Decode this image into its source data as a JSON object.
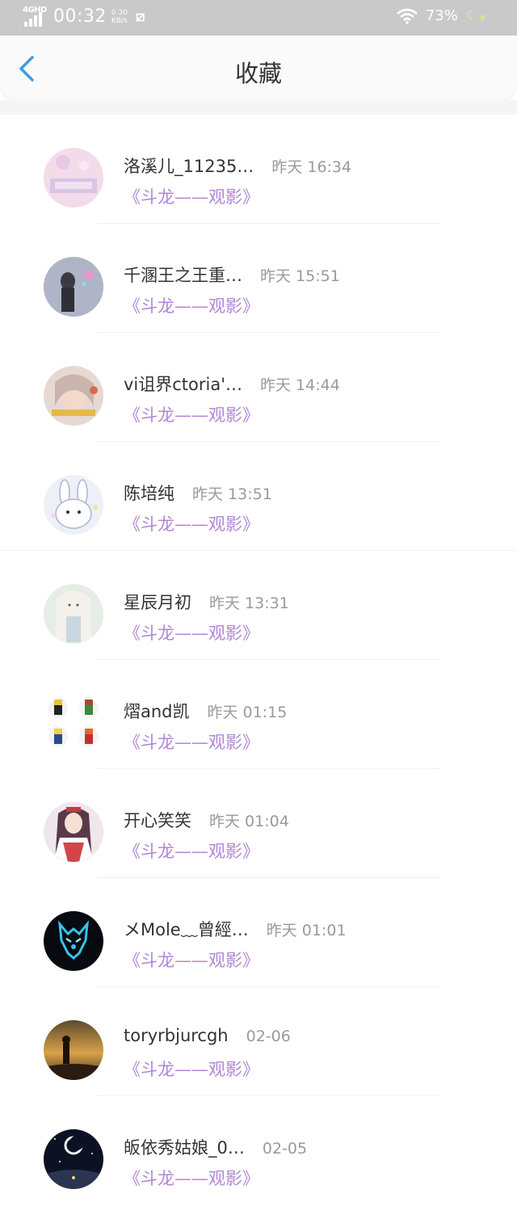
{
  "status_bar": {
    "network": "4GHD",
    "time": "00:32",
    "speed_value": "0.30",
    "speed_unit": "KB/s",
    "battery": "73%"
  },
  "nav": {
    "title": "收藏"
  },
  "items": [
    {
      "name": "洛溪儿_11235…",
      "time": "昨天 16:34",
      "title": "《斗龙——观影》"
    },
    {
      "name": "千溷王之王重…",
      "time": "昨天 15:51",
      "title": "《斗龙——观影》"
    },
    {
      "name": "vi诅界ctoria'…",
      "time": "昨天 14:44",
      "title": "《斗龙——观影》"
    },
    {
      "name": "陈培纯",
      "time": "昨天 13:51",
      "title": "《斗龙——观影》"
    },
    {
      "name": "星辰月初",
      "time": "昨天 13:31",
      "title": "《斗龙——观影》"
    },
    {
      "name": "熠and凯",
      "time": "昨天 01:15",
      "title": "《斗龙——观影》"
    },
    {
      "name": "开心笑笑",
      "time": "昨天 01:04",
      "title": "《斗龙——观影》"
    },
    {
      "name": "メMole﹏曾經…",
      "time": "昨天 01:01",
      "title": "《斗龙——观影》"
    },
    {
      "name": "toryrbjurcgh",
      "time": "02-06",
      "title": "《斗龙——观影》"
    },
    {
      "name": "皈依秀姑娘_0…",
      "time": "02-05",
      "title": "《斗龙——观影》"
    }
  ],
  "colors": {
    "accent_back": "#3a9ee6",
    "title_purple": "#b286d6",
    "time_gray": "#9a9a9a"
  }
}
